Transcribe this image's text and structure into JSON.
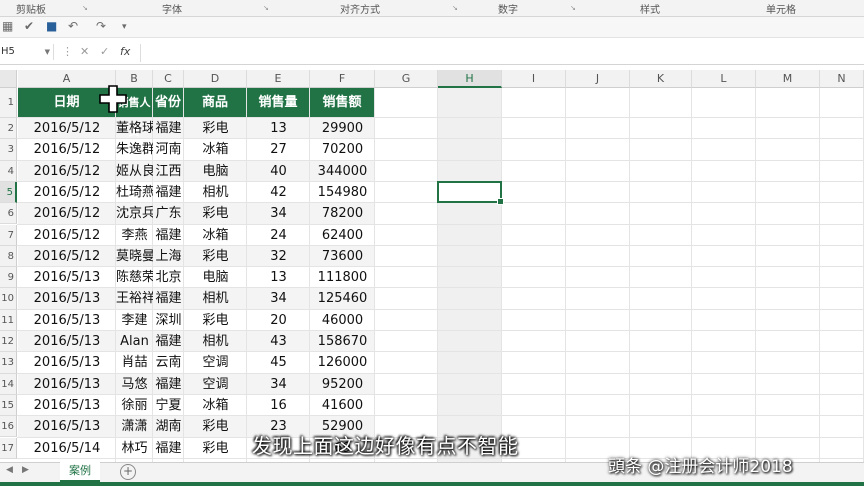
{
  "ribbon": {
    "groups": [
      "剪贴板",
      "字体",
      "对齐方式",
      "数字",
      "样式",
      "单元格"
    ]
  },
  "formula_bar": {
    "name_box": "H5",
    "fx": "fx"
  },
  "sheet": {
    "columns": [
      "A",
      "B",
      "C",
      "D",
      "E",
      "F",
      "G",
      "H",
      "I",
      "J",
      "K",
      "L",
      "M",
      "N"
    ],
    "active_column": "H",
    "rows": [
      "1",
      "2",
      "3",
      "4",
      "5",
      "6",
      "7",
      "8",
      "9",
      "10",
      "11",
      "12",
      "13",
      "14",
      "15",
      "16",
      "17"
    ],
    "active_row": "5",
    "header": [
      "日期",
      "销售人员",
      "省份",
      "商品",
      "销售量",
      "销售额"
    ],
    "data": [
      [
        "2016/5/12",
        "董格球",
        "福建",
        "彩电",
        "13",
        "29900"
      ],
      [
        "2016/5/12",
        "朱逸群",
        "河南",
        "冰箱",
        "27",
        "70200"
      ],
      [
        "2016/5/12",
        "姬从良",
        "江西",
        "电脑",
        "40",
        "344000"
      ],
      [
        "2016/5/12",
        "杜琦燕",
        "福建",
        "相机",
        "42",
        "154980"
      ],
      [
        "2016/5/12",
        "沈京兵",
        "广东",
        "彩电",
        "34",
        "78200"
      ],
      [
        "2016/5/12",
        "李燕",
        "福建",
        "冰箱",
        "24",
        "62400"
      ],
      [
        "2016/5/12",
        "莫晓曼",
        "上海",
        "彩电",
        "32",
        "73600"
      ],
      [
        "2016/5/13",
        "陈慈荣",
        "北京",
        "电脑",
        "13",
        "111800"
      ],
      [
        "2016/5/13",
        "王裕祥",
        "福建",
        "相机",
        "34",
        "125460"
      ],
      [
        "2016/5/13",
        "李建",
        "深圳",
        "彩电",
        "20",
        "46000"
      ],
      [
        "2016/5/13",
        "Alan",
        "福建",
        "相机",
        "43",
        "158670"
      ],
      [
        "2016/5/13",
        "肖喆",
        "云南",
        "空调",
        "45",
        "126000"
      ],
      [
        "2016/5/13",
        "马悠",
        "福建",
        "空调",
        "34",
        "95200"
      ],
      [
        "2016/5/13",
        "徐丽",
        "宁夏",
        "冰箱",
        "16",
        "41600"
      ],
      [
        "2016/5/13",
        "潇潇",
        "湖南",
        "彩电",
        "23",
        "52900"
      ],
      [
        "2016/5/14",
        "林巧",
        "福建",
        "彩电",
        "",
        "69"
      ]
    ]
  },
  "tabs": {
    "active": "案例",
    "add": "+"
  },
  "overlay": {
    "caption": "发现上面这边好像有点不智能",
    "watermark": "頭条 @注册会计师2018"
  },
  "colors": {
    "accent": "#217346",
    "header_fill": "#217346"
  }
}
